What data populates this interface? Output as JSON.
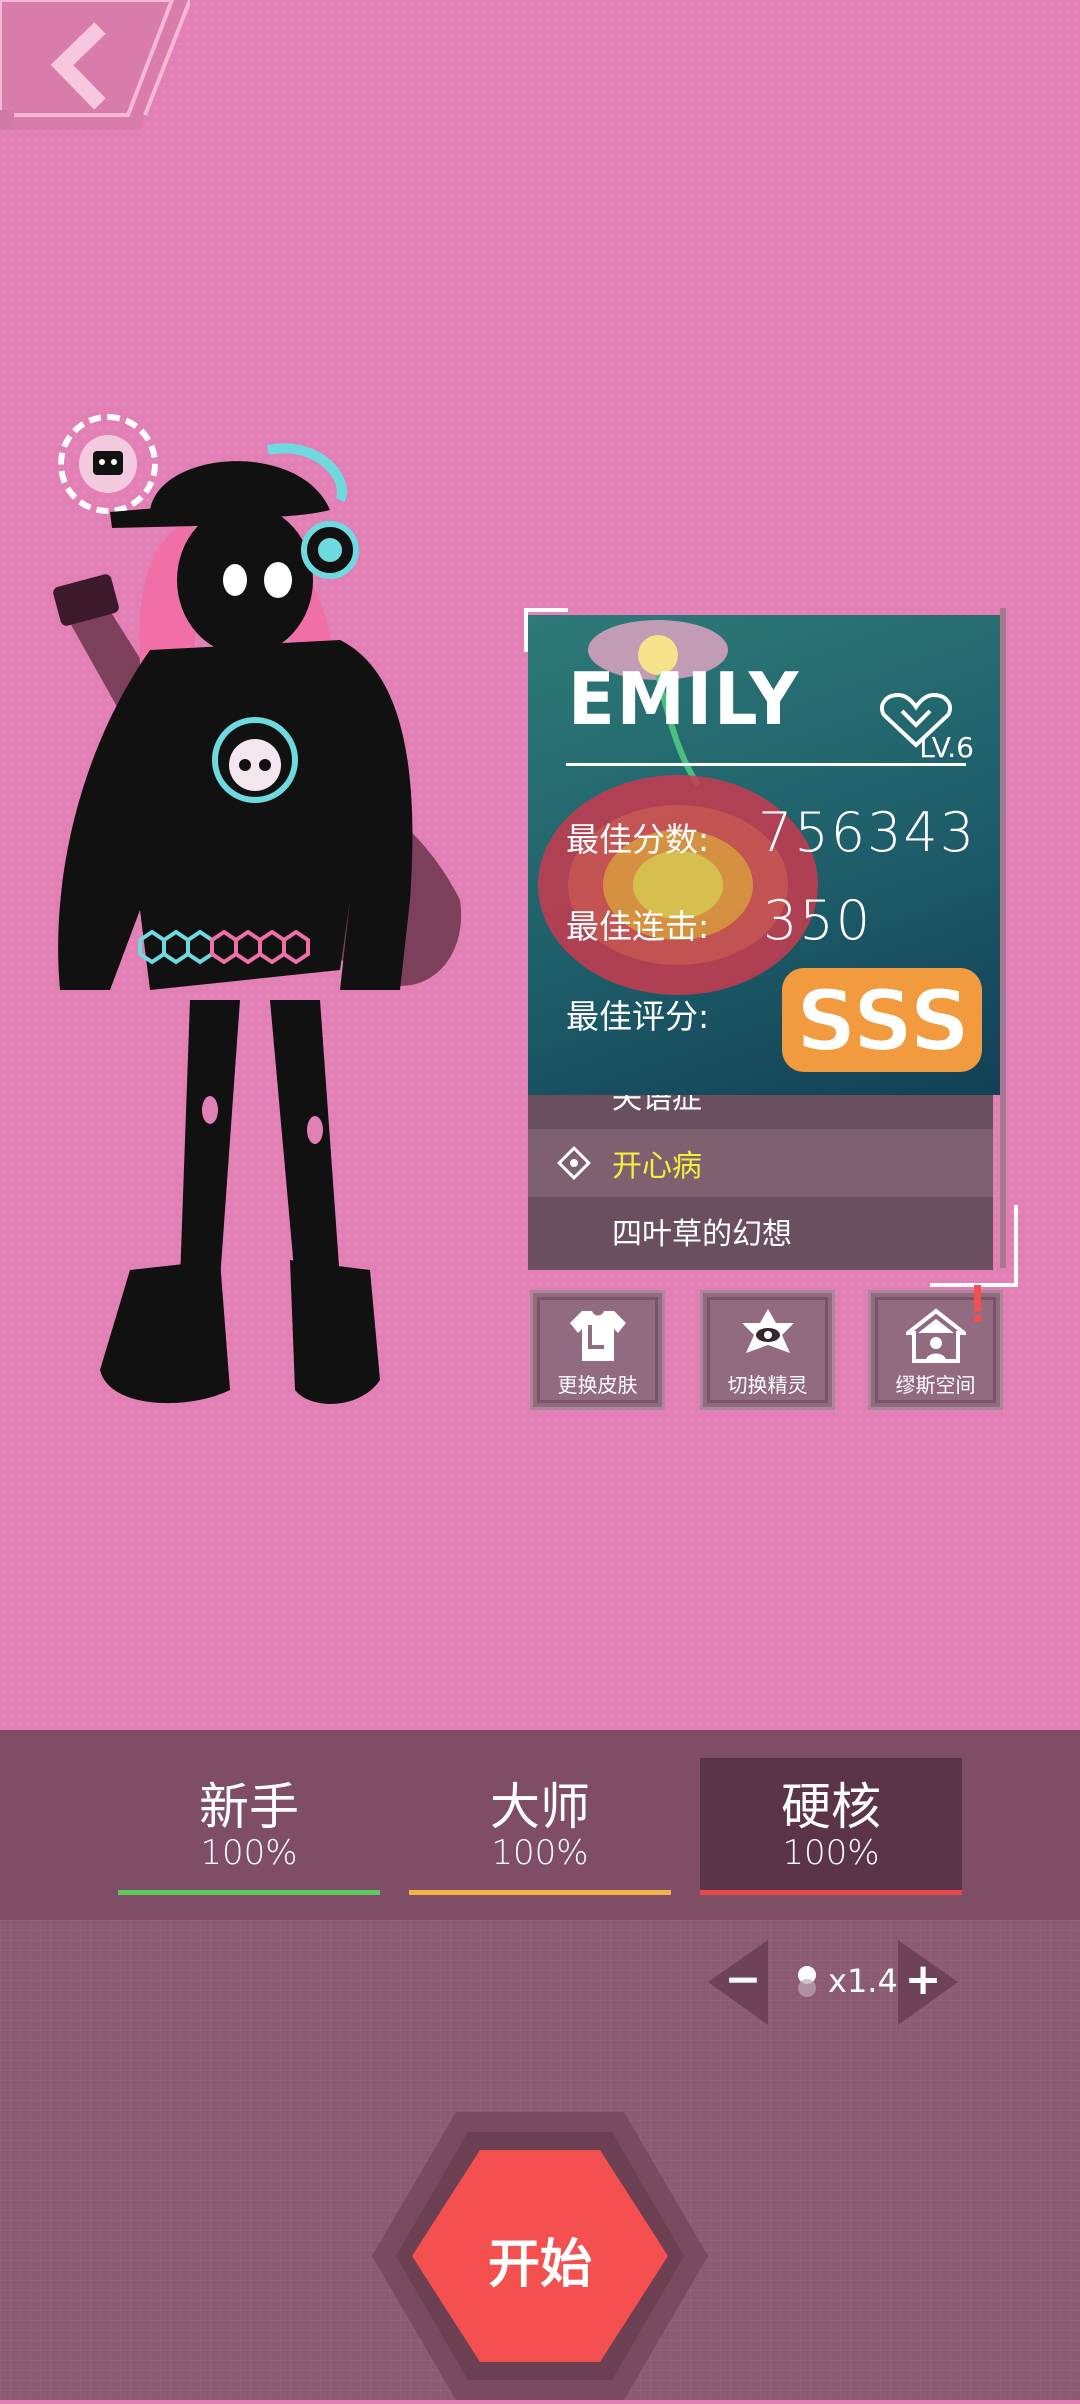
{
  "header": {
    "back_icon": "chevron-left-icon"
  },
  "character": {
    "name": "EMILY",
    "level": "LV.6",
    "stats": [
      {
        "label": "最佳分数:",
        "value": "756343"
      },
      {
        "label": "最佳连击:",
        "value": "350"
      },
      {
        "label": "最佳评分:",
        "value": "SSS"
      }
    ]
  },
  "songs": [
    {
      "title": "失语症",
      "selected": false
    },
    {
      "title": "开心病",
      "selected": true
    },
    {
      "title": "四叶草的幻想",
      "selected": false
    }
  ],
  "actions": [
    {
      "label": "更换皮肤",
      "icon": "shirt-icon"
    },
    {
      "label": "切换精灵",
      "icon": "eye-star-icon"
    },
    {
      "label": "缪斯空间",
      "icon": "house-icon"
    }
  ],
  "difficulties": [
    {
      "name": "新手",
      "percent": "100%",
      "color": "#5cc760"
    },
    {
      "name": "大师",
      "percent": "100%",
      "color": "#f2b24a"
    },
    {
      "name": "硬核",
      "percent": "100%",
      "color": "#e9454d",
      "active": true
    }
  ],
  "speed": {
    "minus": "−",
    "plus": "+",
    "value": "x1.4"
  },
  "start": {
    "label": "开始"
  },
  "colors": {
    "accent": "#f4504f",
    "background": "#e27fb4",
    "panel": "#8b5b72"
  }
}
